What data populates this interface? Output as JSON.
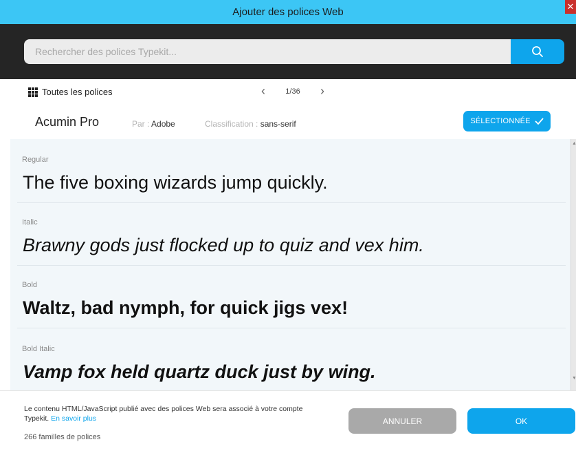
{
  "window": {
    "title": "Ajouter des polices Web",
    "close_glyph": "✕"
  },
  "search": {
    "placeholder": "Rechercher des polices Typekit...",
    "value": "",
    "button_icon": "search-icon"
  },
  "nav": {
    "all_fonts_label": "Toutes les polices",
    "all_fonts_icon": "grid-icon",
    "prev_glyph": "‹",
    "next_glyph": "›",
    "page_indicator": "1/36"
  },
  "font": {
    "name": "Acumin Pro",
    "by_label": "Par : ",
    "by_value": "Adobe",
    "classification_label": "Classification : ",
    "classification_value": "sans-serif",
    "selected_label": "SÉLECTIONNÉE",
    "selected_icon": "check-icon"
  },
  "samples": [
    {
      "style": "Regular",
      "text": "The five boxing wizards jump quickly."
    },
    {
      "style": "Italic",
      "text": "Brawny gods just flocked up to quiz and vex him."
    },
    {
      "style": "Bold",
      "text": "Waltz, bad nymph, for quick jigs vex!"
    },
    {
      "style": "Bold Italic",
      "text": "Vamp fox held quartz duck just by wing."
    }
  ],
  "footer": {
    "notice": "Le contenu HTML/JavaScript publié avec des polices Web sera associé à votre compte Typekit.",
    "learn_more": "En savoir plus",
    "families_count": "266 familles de polices",
    "cancel_label": "ANNULER",
    "ok_label": "OK"
  },
  "colors": {
    "accent": "#0ea5ec",
    "titlebar": "#3cc6f5",
    "search_bg": "#252525",
    "cancel_bg": "#a9a9a9"
  }
}
